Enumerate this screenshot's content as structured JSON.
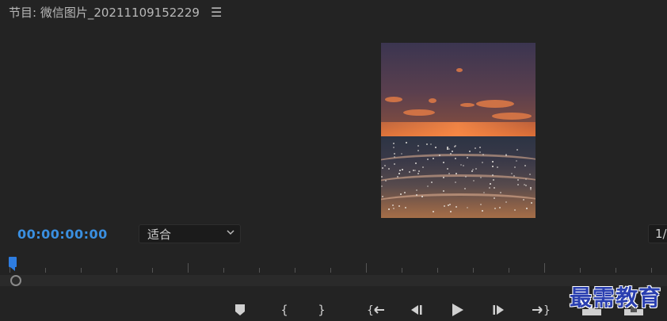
{
  "panel": {
    "title": "节目: 微信图片_20211109152229",
    "menu_icon": "hamburger-menu-icon"
  },
  "preview": {
    "image_alt": "sunset-beach-video-frame"
  },
  "timecode": "00:00:00:00",
  "zoom_select": {
    "value": "适合"
  },
  "resolution_select": {
    "value": "1/"
  },
  "transport": {
    "buttons": [
      {
        "name": "add-marker-button",
        "icon": "marker-icon"
      },
      {
        "name": "mark-in-button",
        "icon": "mark-in-icon"
      },
      {
        "name": "mark-out-button",
        "icon": "mark-out-icon"
      },
      {
        "name": "go-to-in-button",
        "icon": "go-to-in-icon"
      },
      {
        "name": "step-back-button",
        "icon": "step-back-icon"
      },
      {
        "name": "play-button",
        "icon": "play-icon"
      },
      {
        "name": "step-forward-button",
        "icon": "step-forward-icon"
      },
      {
        "name": "go-to-out-button",
        "icon": "go-to-out-icon"
      },
      {
        "name": "insert-button",
        "icon": "insert-icon"
      },
      {
        "name": "overwrite-button",
        "icon": "overwrite-icon"
      }
    ]
  },
  "watermark": "最需教育",
  "colors": {
    "background": "#232323",
    "timecode": "#3a8fe0",
    "playhead": "#2e7de0",
    "watermark": "#2a3fb0"
  }
}
